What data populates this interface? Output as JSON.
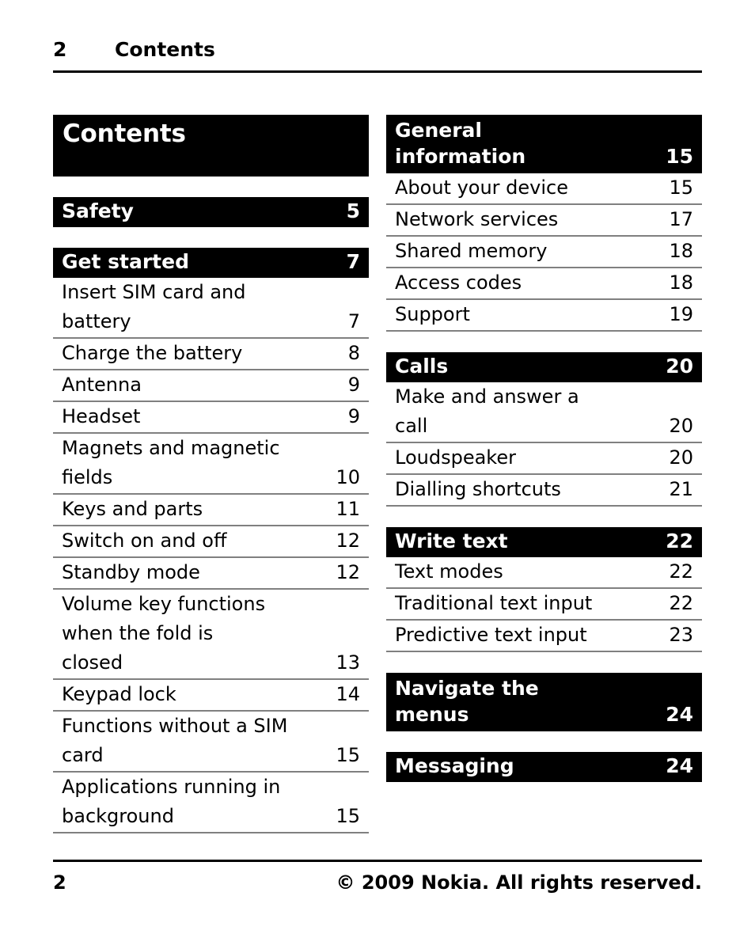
{
  "header": {
    "page_number": "2",
    "title": "Contents"
  },
  "toc_title": "Contents",
  "left_column": [
    {
      "heading": "Safety",
      "heading_page": "5",
      "heading_lines": [
        "Safety"
      ],
      "entries": []
    },
    {
      "heading": "Get started",
      "heading_page": "7",
      "heading_lines": [
        "Get started"
      ],
      "entries": [
        {
          "lines": [
            "Insert SIM card and",
            "battery"
          ],
          "page": "7"
        },
        {
          "lines": [
            "Charge the battery"
          ],
          "page": "8"
        },
        {
          "lines": [
            "Antenna"
          ],
          "page": "9"
        },
        {
          "lines": [
            "Headset"
          ],
          "page": "9"
        },
        {
          "lines": [
            "Magnets and magnetic",
            "fields"
          ],
          "page": "10"
        },
        {
          "lines": [
            "Keys and parts"
          ],
          "page": "11"
        },
        {
          "lines": [
            "Switch on and off"
          ],
          "page": "12"
        },
        {
          "lines": [
            "Standby mode"
          ],
          "page": "12"
        },
        {
          "lines": [
            "Volume key functions",
            "when the fold is",
            "closed"
          ],
          "page": "13"
        },
        {
          "lines": [
            "Keypad lock"
          ],
          "page": "14"
        },
        {
          "lines": [
            "Functions without a SIM",
            "card"
          ],
          "page": "15"
        },
        {
          "lines": [
            "Applications running in",
            "background"
          ],
          "page": "15"
        }
      ]
    }
  ],
  "right_column": [
    {
      "heading": "General information",
      "heading_page": "15",
      "heading_lines": [
        "General",
        "information"
      ],
      "entries": [
        {
          "lines": [
            "About your device"
          ],
          "page": "15"
        },
        {
          "lines": [
            "Network services"
          ],
          "page": "17"
        },
        {
          "lines": [
            "Shared memory"
          ],
          "page": "18"
        },
        {
          "lines": [
            "Access codes"
          ],
          "page": "18"
        },
        {
          "lines": [
            "Support"
          ],
          "page": "19"
        }
      ]
    },
    {
      "heading": "Calls",
      "heading_page": "20",
      "heading_lines": [
        "Calls"
      ],
      "entries": [
        {
          "lines": [
            "Make and answer a",
            "call"
          ],
          "page": "20"
        },
        {
          "lines": [
            "Loudspeaker"
          ],
          "page": "20"
        },
        {
          "lines": [
            "Dialling shortcuts"
          ],
          "page": "21"
        }
      ]
    },
    {
      "heading": "Write text",
      "heading_page": "22",
      "heading_lines": [
        "Write text"
      ],
      "entries": [
        {
          "lines": [
            "Text modes"
          ],
          "page": "22"
        },
        {
          "lines": [
            "Traditional text input"
          ],
          "page": "22"
        },
        {
          "lines": [
            "Predictive text input"
          ],
          "page": "23"
        }
      ]
    },
    {
      "heading": "Navigate the menus",
      "heading_page": "24",
      "heading_lines": [
        "Navigate the",
        "menus"
      ],
      "entries": []
    },
    {
      "heading": "Messaging",
      "heading_page": "24",
      "heading_lines": [
        "Messaging"
      ],
      "entries": []
    }
  ],
  "footer": {
    "page_number": "2",
    "copyright": "© 2009 Nokia. All rights reserved."
  }
}
